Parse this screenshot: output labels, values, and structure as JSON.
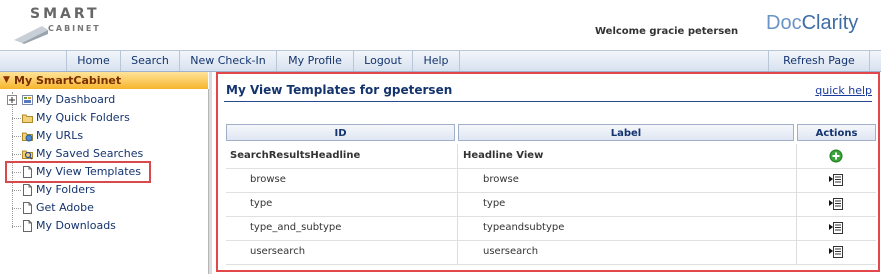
{
  "header": {
    "logo_top": "SMART",
    "logo_bottom": "CABINET",
    "welcome": "Welcome gracie petersen",
    "brand_a": "Doc",
    "brand_b": "Clarity"
  },
  "nav": {
    "items": [
      "Home",
      "Search",
      "New Check-In",
      "My Profile",
      "Logout",
      "Help"
    ],
    "refresh": "Refresh Page"
  },
  "sidebar": {
    "title": "My SmartCabinet",
    "items": [
      {
        "label": "My Dashboard",
        "icon": "dashboard-icon"
      },
      {
        "label": "My Quick Folders",
        "icon": "folder-icon"
      },
      {
        "label": "My URLs",
        "icon": "url-icon"
      },
      {
        "label": "My Saved Searches",
        "icon": "saved-search-icon"
      },
      {
        "label": "My View Templates",
        "icon": "document-icon"
      },
      {
        "label": "My Folders",
        "icon": "document-icon"
      },
      {
        "label": "Get Adobe",
        "icon": "document-icon"
      },
      {
        "label": "My Downloads",
        "icon": "document-icon"
      }
    ]
  },
  "main": {
    "title": "My View Templates for gpetersen",
    "quick_help": "quick help",
    "columns": [
      "ID",
      "Label",
      "Actions"
    ],
    "rows": [
      {
        "id": "SearchResultsHeadline",
        "label": "Headline View",
        "action": "add-icon",
        "bold": true
      },
      {
        "id": "browse",
        "label": "browse",
        "action": "view-list-icon",
        "bold": false
      },
      {
        "id": "type",
        "label": "type",
        "action": "view-list-icon",
        "bold": false
      },
      {
        "id": "type_and_subtype",
        "label": "typeandsubtype",
        "action": "view-list-icon",
        "bold": false
      },
      {
        "id": "usersearch",
        "label": "usersearch",
        "action": "view-list-icon",
        "bold": false
      }
    ]
  },
  "colors": {
    "accent_red": "#e2474a",
    "nav_text": "#14346e",
    "sidebar_header": "#f6b52c"
  }
}
